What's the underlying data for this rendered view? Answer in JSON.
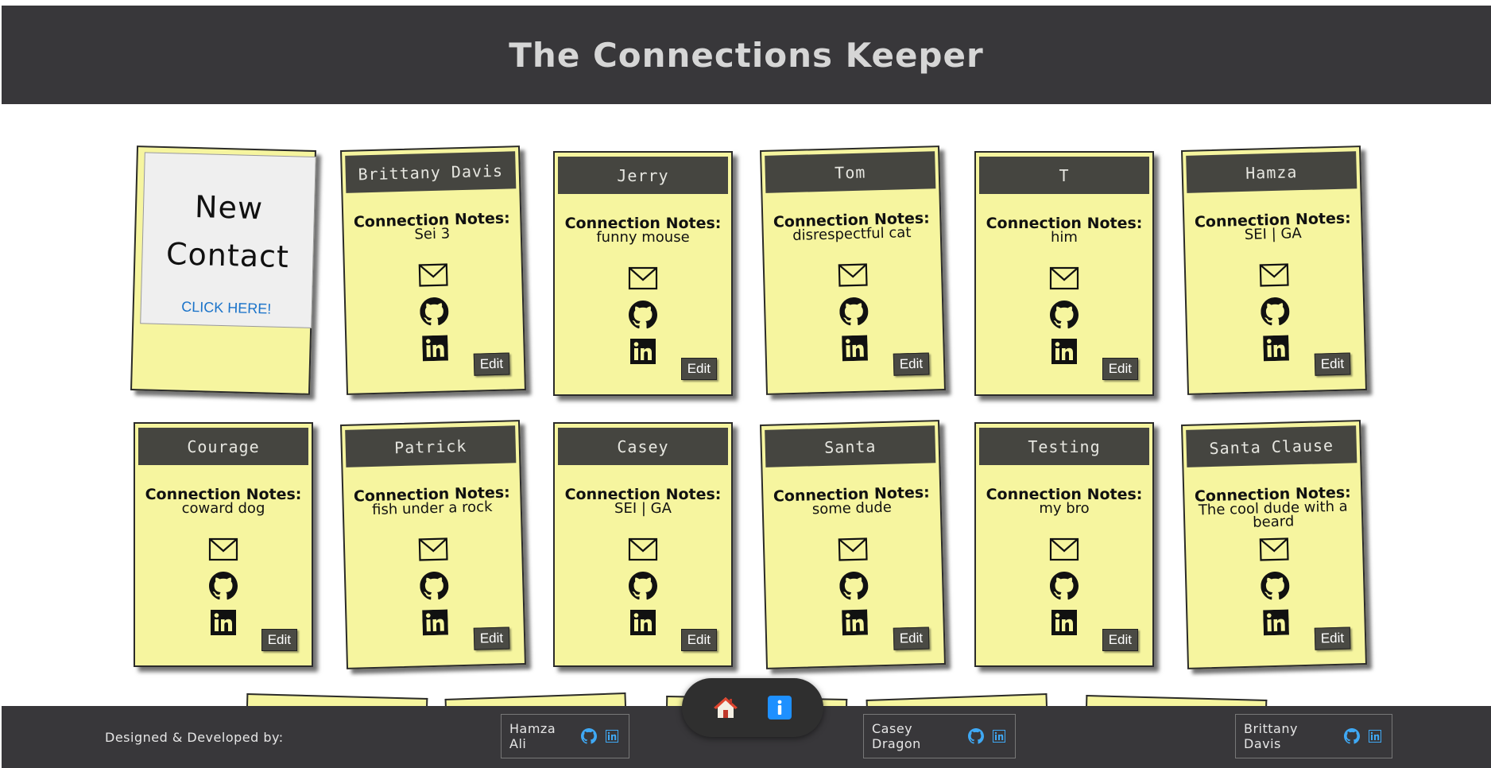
{
  "header": {
    "title": "The Connections Keeper"
  },
  "new_contact": {
    "title_line1": "New",
    "title_line2": "Contact",
    "link": "CLICK HERE!"
  },
  "card_labels": {
    "notes_label": "Connection Notes:",
    "edit": "Edit"
  },
  "contacts": [
    {
      "name": "Brittany Davis",
      "notes": "Sei 3"
    },
    {
      "name": "Jerry",
      "notes": "funny mouse"
    },
    {
      "name": "Tom",
      "notes": "disrespectful cat"
    },
    {
      "name": "T",
      "notes": "him"
    },
    {
      "name": "Hamza",
      "notes": "SEI | GA"
    },
    {
      "name": "Courage",
      "notes": "coward dog"
    },
    {
      "name": "Patrick",
      "notes": "fish under a rock"
    },
    {
      "name": "Casey",
      "notes": "SEI | GA"
    },
    {
      "name": "Santa",
      "notes": "some dude"
    },
    {
      "name": "Testing",
      "notes": "my bro"
    },
    {
      "name": "Santa Clause",
      "notes": "The cool dude with a beard"
    }
  ],
  "footer": {
    "credit": "Designed & Developed by:",
    "developers": [
      {
        "name": "Hamza Ali"
      },
      {
        "name": "Casey Dragon"
      },
      {
        "name": "Brittany Davis"
      }
    ]
  },
  "nav": {
    "home_icon": "home-icon",
    "info_icon": "info-icon"
  },
  "colors": {
    "card": "#f6f59f",
    "header": "#38373a",
    "name_bar": "#454540",
    "info_blue": "#1e90ff"
  }
}
